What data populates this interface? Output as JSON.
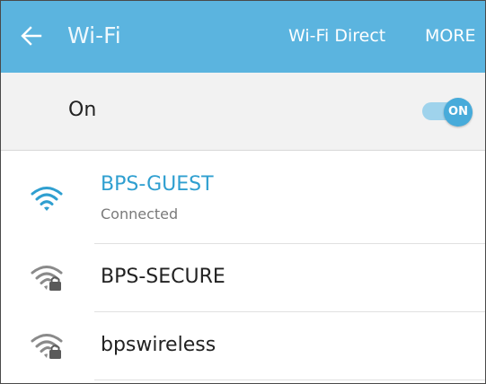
{
  "header": {
    "title": "Wi-Fi",
    "back_icon": "arrow-left-icon",
    "actions": [
      "Wi-Fi Direct",
      "MORE"
    ]
  },
  "toggle": {
    "label": "On",
    "switch_label": "ON",
    "state": "on"
  },
  "networks": [
    {
      "name": "BPS-GUEST",
      "status": "Connected",
      "icon": "wifi-signal-icon",
      "secured": false
    },
    {
      "name": "BPS-SECURE",
      "icon": "wifi-lock-icon",
      "secured": true
    },
    {
      "name": "bpswireless",
      "icon": "wifi-lock-icon",
      "secured": true
    }
  ],
  "colors": {
    "appbar": "#5bb4df",
    "accent": "#2f9fd0",
    "switch_knob": "#47abda",
    "switch_track": "#9fd3ec",
    "toggle_row_bg": "#f2f2f2"
  }
}
